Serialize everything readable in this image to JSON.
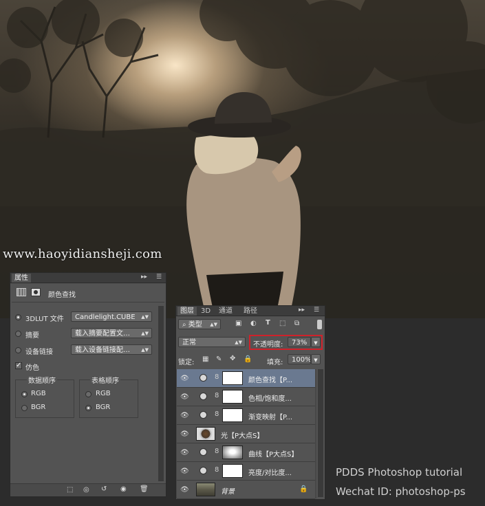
{
  "watermark": "www.haoyidiansheji.com",
  "credits": {
    "line1": "PDDS Photoshop tutorial",
    "line2": "Wechat ID: photoshop-ps"
  },
  "properties": {
    "tab": "属性",
    "header_title": "颜色查找",
    "rows": [
      {
        "label": "3DLUT 文件",
        "value": "Candlelight.CUBE",
        "selected": true
      },
      {
        "label": "摘要",
        "value": "载入摘要配置文…",
        "selected": false
      },
      {
        "label": "设备链接",
        "value": "载入设备链接配…",
        "selected": false
      }
    ],
    "dither_label": "仿色",
    "dither_checked": true,
    "data_order": {
      "title": "数据顺序",
      "options": [
        "RGB",
        "BGR"
      ],
      "selected": "RGB"
    },
    "table_order": {
      "title": "表格顺序",
      "options": [
        "RGB",
        "BGR"
      ],
      "selected": "BGR"
    },
    "ctl": "▸▸"
  },
  "layers": {
    "tabs": [
      "图层",
      "3D",
      "通道",
      "路径"
    ],
    "active_tab": "图层",
    "filter_kind": "类型",
    "blend_mode": "正常",
    "opacity_label": "不透明度:",
    "opacity_value": "73%",
    "lock_label": "锁定:",
    "fill_label": "填充:",
    "fill_value": "100%",
    "items": [
      {
        "name": "颜色查找【P...",
        "type": "adjustment",
        "selected": true
      },
      {
        "name": "色相/饱和度...",
        "type": "adjustment",
        "selected": false
      },
      {
        "name": "渐变映射【P...",
        "type": "adjustment",
        "selected": false
      },
      {
        "name": "光【P大点S】",
        "type": "pixel",
        "selected": false
      },
      {
        "name": "曲线【P大点S】",
        "type": "adjustment",
        "selected": false
      },
      {
        "name": "亮度/对比度...",
        "type": "adjustment",
        "selected": false
      },
      {
        "name": "背景",
        "type": "background",
        "selected": false
      }
    ],
    "highlight_color": "#d0212a"
  }
}
